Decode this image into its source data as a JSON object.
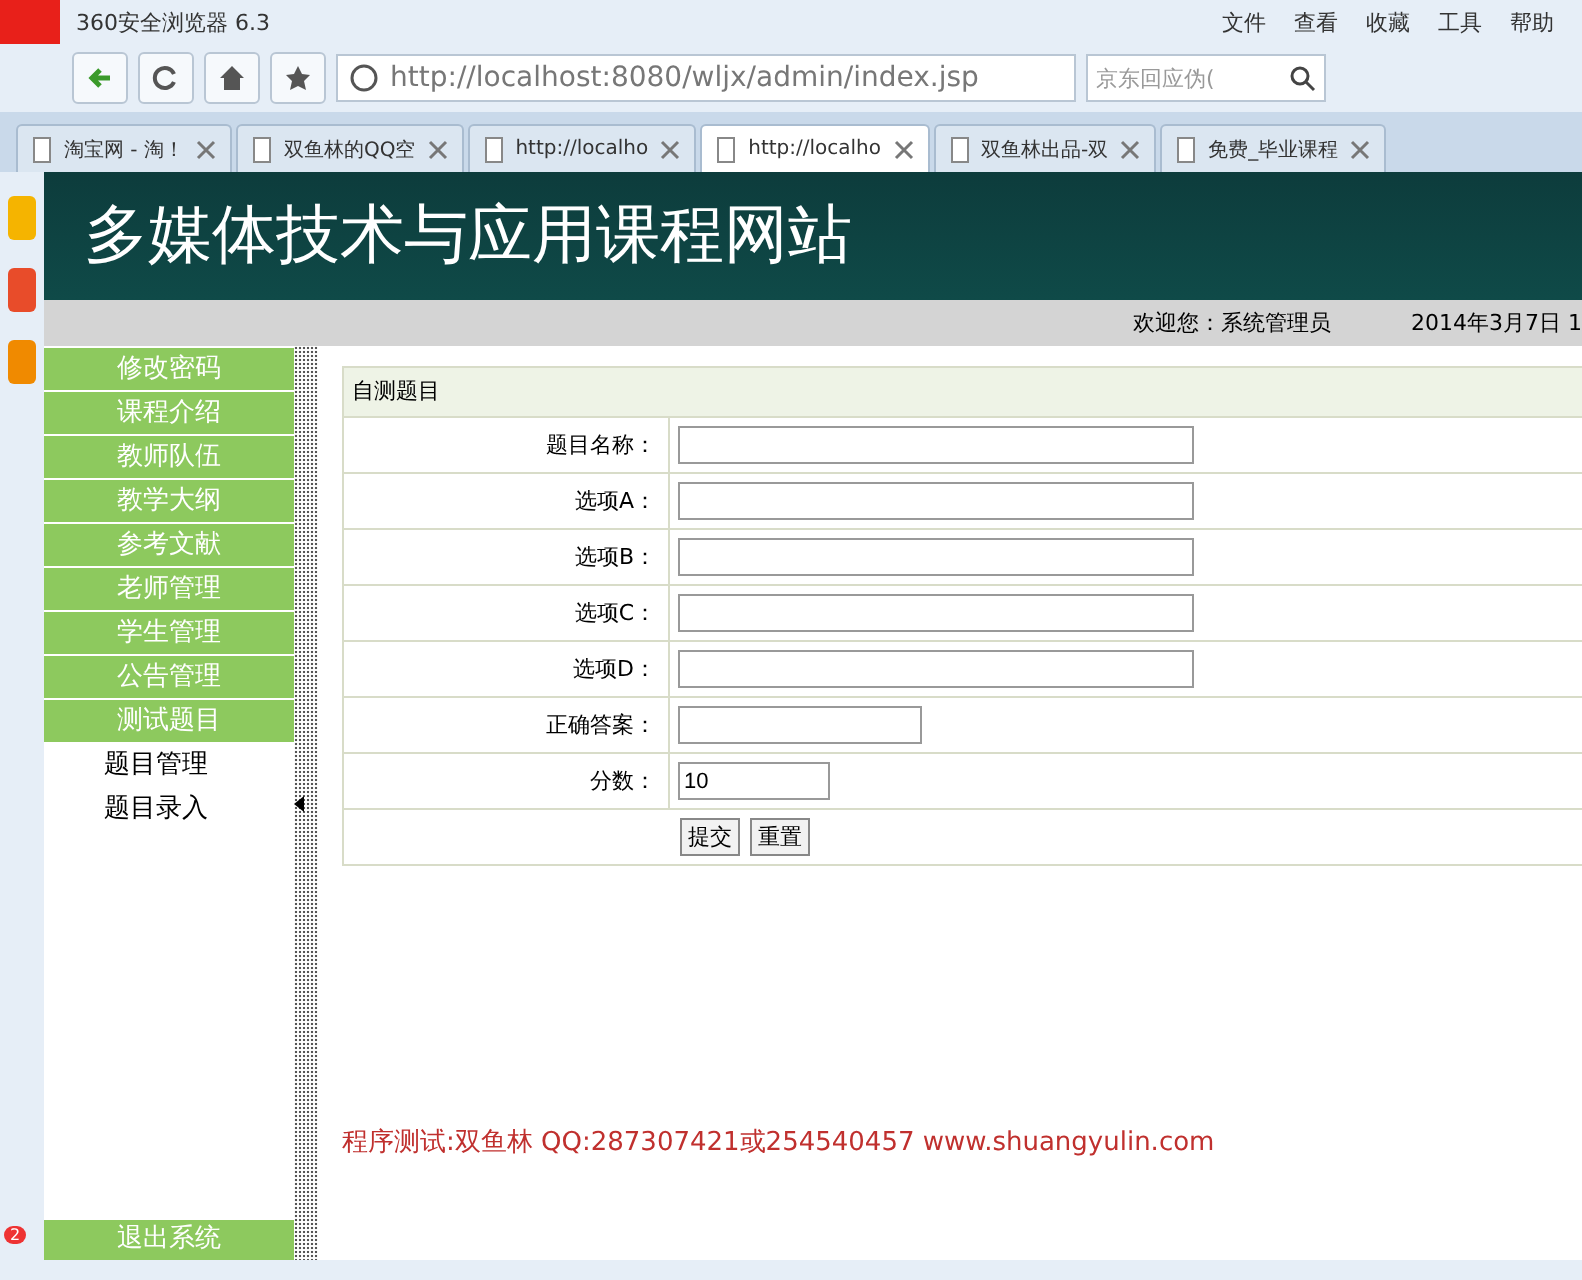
{
  "browser": {
    "title": "360安全浏览器 6.3",
    "menu": [
      "文件",
      "查看",
      "收藏",
      "工具",
      "帮助"
    ],
    "url": "http://localhost:8080/wljx/admin/index.jsp",
    "search_placeholder": "京东回应伪(",
    "tabs": [
      {
        "label": "淘宝网 - 淘！",
        "selected": false
      },
      {
        "label": "双鱼林的QQ空",
        "selected": false
      },
      {
        "label": "http://localho",
        "selected": false
      },
      {
        "label": "http://localho",
        "selected": true
      },
      {
        "label": "双鱼林出品-双",
        "selected": false
      },
      {
        "label": "免费_毕业课程",
        "selected": false
      }
    ],
    "dock_badge": "2"
  },
  "page": {
    "site_title": "多媒体技术与应用课程网站",
    "welcome": "欢迎您：系统管理员",
    "date": "2014年3月7日  1",
    "sidebar": {
      "items": [
        {
          "label": "修改密码"
        },
        {
          "label": "课程介绍"
        },
        {
          "label": "教师队伍"
        },
        {
          "label": "教学大纲"
        },
        {
          "label": "参考文献"
        },
        {
          "label": "老师管理"
        },
        {
          "label": "学生管理"
        },
        {
          "label": "公告管理"
        },
        {
          "label": "测试题目",
          "children": [
            {
              "label": "题目管理"
            },
            {
              "label": "题目录入"
            }
          ]
        }
      ],
      "logout": "退出系统"
    },
    "form": {
      "title": "自测题目",
      "fields": [
        {
          "label": "题目名称：",
          "kind": "wide"
        },
        {
          "label": "选项A：",
          "kind": "wide"
        },
        {
          "label": "选项B：",
          "kind": "wide"
        },
        {
          "label": "选项C：",
          "kind": "wide"
        },
        {
          "label": "选项D：",
          "kind": "wide"
        },
        {
          "label": "正确答案：",
          "kind": "medium"
        },
        {
          "label": "分数：",
          "kind": "small",
          "value": "10"
        }
      ],
      "buttons": [
        "提交",
        "重置"
      ]
    },
    "footer_note": "程序测试:双鱼林 QQ:287307421或254540457 www.shuangyulin.com"
  }
}
